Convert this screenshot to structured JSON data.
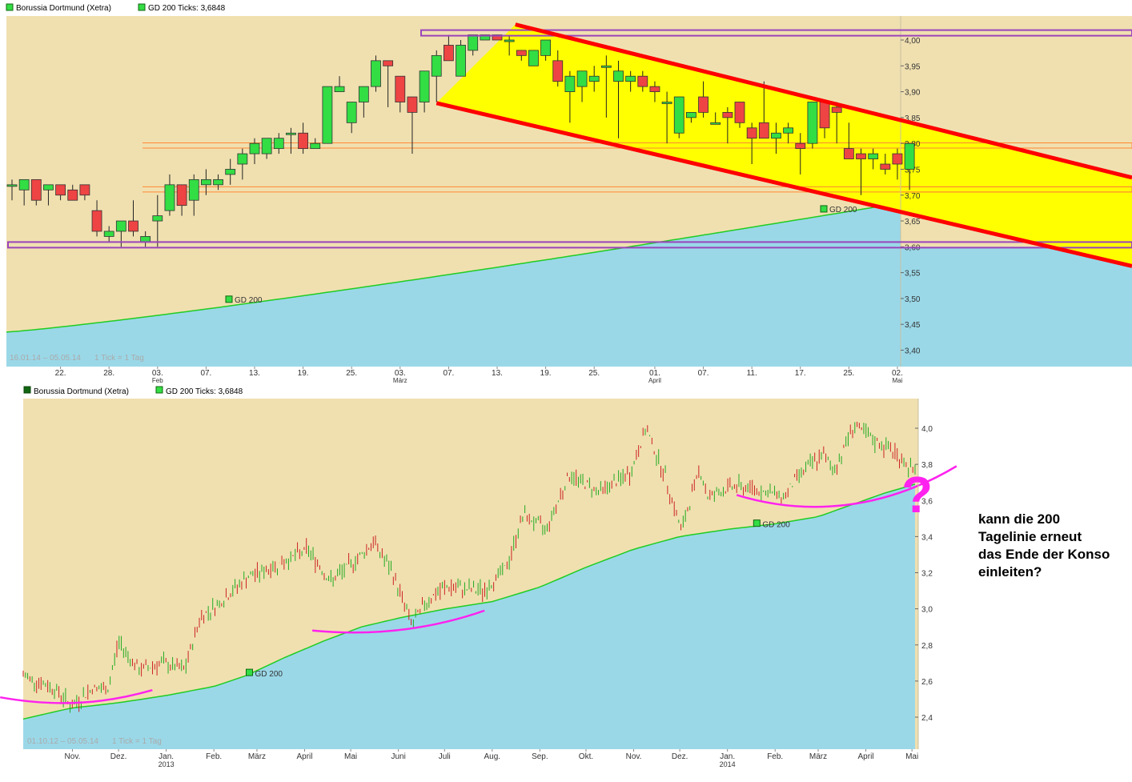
{
  "annotation": {
    "question_mark": "?",
    "lines": [
      "kann die 200",
      "Tagelinie erneut",
      "das Ende der Konso",
      "einleiten?"
    ]
  },
  "colors": {
    "up_candle": "#33dd44",
    "down_candle": "#ee4444",
    "price_area": "#f0e0b0",
    "ma_area": "#9ad8e8",
    "ma_line": "#22cc22",
    "channel": "#ff0000",
    "channel_fill": "#ffff00",
    "box_outline": "#9944bb",
    "hline": "#ff8833",
    "bars": "#cc2222",
    "bars_up": "#22aa22",
    "annotation": "#ff22ee"
  },
  "chart_data": [
    {
      "type": "candlestick",
      "title": "Borussia Dortmund (Xetra)",
      "legend": [
        {
          "label": "Borussia Dortmund (Xetra)",
          "color": "#33dd44"
        },
        {
          "label": "GD 200 Ticks: 3,6848",
          "color": "#33dd44"
        }
      ],
      "range_label": "16.01.14 – 05.05.14",
      "tick_label": "1 Tick = 1 Tag",
      "y_ticks": [
        "3,40",
        "3,45",
        "3,50",
        "3,55",
        "3,60",
        "3,65",
        "3,70",
        "3,75",
        "3,80",
        "3,85",
        "3,90",
        "3,95",
        "4,00"
      ],
      "y_tick_values": [
        3.4,
        3.45,
        3.5,
        3.55,
        3.6,
        3.65,
        3.7,
        3.75,
        3.8,
        3.85,
        3.9,
        3.95,
        4.0
      ],
      "ylim": [
        3.365,
        4.03
      ],
      "x_labels": [
        {
          "i": 4,
          "label": "22."
        },
        {
          "i": 8,
          "label": "28."
        },
        {
          "i": 12,
          "label": "03.",
          "sub": "Feb"
        },
        {
          "i": 16,
          "label": "07."
        },
        {
          "i": 20,
          "label": "13."
        },
        {
          "i": 24,
          "label": "19."
        },
        {
          "i": 28,
          "label": "25."
        },
        {
          "i": 32,
          "label": "03.",
          "sub": "März"
        },
        {
          "i": 36,
          "label": "07."
        },
        {
          "i": 40,
          "label": "13."
        },
        {
          "i": 44,
          "label": "19."
        },
        {
          "i": 48,
          "label": "25."
        },
        {
          "i": 53,
          "label": "01.",
          "sub": "April"
        },
        {
          "i": 57,
          "label": "07."
        },
        {
          "i": 61,
          "label": "11."
        },
        {
          "i": 65,
          "label": "17."
        },
        {
          "i": 69,
          "label": "25."
        },
        {
          "i": 73,
          "label": "02.",
          "sub": "Mai"
        }
      ],
      "candles": [
        [
          3.72,
          3.73,
          3.69,
          3.72
        ],
        [
          3.71,
          3.72,
          3.68,
          3.73
        ],
        [
          3.73,
          3.73,
          3.68,
          3.69
        ],
        [
          3.71,
          3.72,
          3.68,
          3.72
        ],
        [
          3.72,
          3.72,
          3.69,
          3.7
        ],
        [
          3.71,
          3.72,
          3.69,
          3.69
        ],
        [
          3.72,
          3.72,
          3.69,
          3.7
        ],
        [
          3.67,
          3.69,
          3.62,
          3.63
        ],
        [
          3.62,
          3.64,
          3.61,
          3.63
        ],
        [
          3.63,
          3.65,
          3.6,
          3.65
        ],
        [
          3.65,
          3.69,
          3.62,
          3.63
        ],
        [
          3.61,
          3.63,
          3.6,
          3.62
        ],
        [
          3.65,
          3.7,
          3.6,
          3.66
        ],
        [
          3.67,
          3.74,
          3.66,
          3.72
        ],
        [
          3.72,
          3.72,
          3.66,
          3.68
        ],
        [
          3.69,
          3.74,
          3.66,
          3.73
        ],
        [
          3.72,
          3.75,
          3.7,
          3.73
        ],
        [
          3.72,
          3.74,
          3.71,
          3.73
        ],
        [
          3.74,
          3.77,
          3.72,
          3.75
        ],
        [
          3.76,
          3.79,
          3.73,
          3.78
        ],
        [
          3.78,
          3.81,
          3.76,
          3.8
        ],
        [
          3.78,
          3.81,
          3.77,
          3.81
        ],
        [
          3.79,
          3.82,
          3.78,
          3.81
        ],
        [
          3.82,
          3.83,
          3.78,
          3.82
        ],
        [
          3.82,
          3.84,
          3.78,
          3.79
        ],
        [
          3.79,
          3.81,
          3.79,
          3.8
        ],
        [
          3.8,
          3.91,
          3.8,
          3.91
        ],
        [
          3.9,
          3.93,
          3.9,
          3.91
        ],
        [
          3.84,
          3.88,
          3.82,
          3.88
        ],
        [
          3.88,
          3.9,
          3.85,
          3.91
        ],
        [
          3.91,
          3.97,
          3.9,
          3.96
        ],
        [
          3.96,
          3.96,
          3.87,
          3.95
        ],
        [
          3.93,
          3.93,
          3.86,
          3.88
        ],
        [
          3.89,
          3.89,
          3.78,
          3.86
        ],
        [
          3.88,
          3.93,
          3.86,
          3.94
        ],
        [
          3.93,
          3.98,
          3.88,
          3.97
        ],
        [
          3.99,
          4.01,
          3.96,
          3.96
        ],
        [
          3.93,
          4.0,
          3.93,
          3.99
        ],
        [
          3.98,
          4.0,
          3.97,
          4.01
        ],
        [
          4.0,
          4.01,
          4.0,
          4.01
        ],
        [
          4.01,
          4.01,
          4.0,
          4.0
        ],
        [
          4.0,
          4.01,
          3.97,
          4.0
        ],
        [
          3.98,
          3.98,
          3.96,
          3.97
        ],
        [
          3.95,
          3.98,
          3.95,
          3.98
        ],
        [
          3.97,
          4.0,
          3.96,
          4.0
        ],
        [
          3.96,
          3.98,
          3.91,
          3.92
        ],
        [
          3.9,
          3.94,
          3.84,
          3.93
        ],
        [
          3.91,
          3.94,
          3.88,
          3.94
        ],
        [
          3.92,
          3.95,
          3.9,
          3.93
        ],
        [
          3.95,
          3.97,
          3.85,
          3.95
        ],
        [
          3.92,
          3.96,
          3.81,
          3.94
        ],
        [
          3.92,
          3.94,
          3.9,
          3.93
        ],
        [
          3.93,
          3.94,
          3.9,
          3.91
        ],
        [
          3.91,
          3.92,
          3.88,
          3.9
        ],
        [
          3.88,
          3.9,
          3.8,
          3.88
        ],
        [
          3.82,
          3.89,
          3.81,
          3.89
        ],
        [
          3.85,
          3.86,
          3.84,
          3.86
        ],
        [
          3.89,
          3.92,
          3.85,
          3.86
        ],
        [
          3.84,
          3.86,
          3.84,
          3.84
        ],
        [
          3.86,
          3.87,
          3.8,
          3.85
        ],
        [
          3.88,
          3.88,
          3.83,
          3.84
        ],
        [
          3.83,
          3.84,
          3.76,
          3.81
        ],
        [
          3.84,
          3.92,
          3.81,
          3.81
        ],
        [
          3.81,
          3.84,
          3.78,
          3.82
        ],
        [
          3.82,
          3.84,
          3.8,
          3.83
        ],
        [
          3.8,
          3.82,
          3.74,
          3.79
        ],
        [
          3.8,
          3.88,
          3.79,
          3.88
        ],
        [
          3.88,
          3.88,
          3.81,
          3.83
        ],
        [
          3.87,
          3.88,
          3.8,
          3.86
        ],
        [
          3.79,
          3.84,
          3.78,
          3.77
        ],
        [
          3.78,
          3.79,
          3.7,
          3.77
        ],
        [
          3.77,
          3.79,
          3.75,
          3.78
        ],
        [
          3.76,
          3.78,
          3.74,
          3.75
        ],
        [
          3.78,
          3.79,
          3.73,
          3.76
        ],
        [
          3.75,
          3.8,
          3.71,
          3.8
        ]
      ],
      "ma_200_start": 3.435,
      "ma_200_end": 3.685,
      "ma_label": "GD 200",
      "horizontal_levels": [
        3.801,
        3.791,
        3.716,
        3.706
      ],
      "resistance_box": [
        4.013,
        4.005
      ],
      "support_box": [
        3.603,
        3.596
      ],
      "channel_upper": [
        [
          41.5,
          4.03
        ],
        [
          87.0,
          3.765
        ]
      ],
      "channel_lower": [
        [
          35.0,
          3.878
        ],
        [
          87.0,
          3.592
        ]
      ]
    },
    {
      "type": "bar",
      "title": "Borussia Dortmund (Xetra)",
      "legend": [
        {
          "label": "Borussia Dortmund (Xetra)",
          "color": "#116611"
        },
        {
          "label": "GD 200 Ticks: 3,6848",
          "color": "#33dd44"
        }
      ],
      "range_label": "01.10.12 – 05.05.14",
      "tick_label": "1 Tick = 1 Tag",
      "y_ticks": [
        "2,4",
        "2,6",
        "2,8",
        "3,0",
        "3,2",
        "3,4",
        "3,6",
        "3,8",
        "4,0"
      ],
      "y_tick_values": [
        2.4,
        2.6,
        2.8,
        3.0,
        3.2,
        3.4,
        3.6,
        3.8,
        4.0
      ],
      "ylim": [
        2.2,
        4.04
      ],
      "x_labels": [
        {
          "d": 32,
          "label": "Nov."
        },
        {
          "d": 62,
          "label": "Dez."
        },
        {
          "d": 93,
          "label": "Jan.",
          "sub": "2013"
        },
        {
          "d": 124,
          "label": "Feb."
        },
        {
          "d": 152,
          "label": "März"
        },
        {
          "d": 183,
          "label": "April"
        },
        {
          "d": 213,
          "label": "Mai"
        },
        {
          "d": 244,
          "label": "Juni"
        },
        {
          "d": 274,
          "label": "Juli"
        },
        {
          "d": 305,
          "label": "Aug."
        },
        {
          "d": 336,
          "label": "Sep."
        },
        {
          "d": 366,
          "label": "Okt."
        },
        {
          "d": 397,
          "label": "Nov."
        },
        {
          "d": 427,
          "label": "Dez."
        },
        {
          "d": 458,
          "label": "Jan.",
          "sub": "2014"
        },
        {
          "d": 489,
          "label": "Feb."
        },
        {
          "d": 517,
          "label": "März"
        },
        {
          "d": 548,
          "label": "April"
        },
        {
          "d": 578,
          "label": "Mai"
        }
      ],
      "price_path": [
        [
          0,
          2.63
        ],
        [
          20,
          2.56
        ],
        [
          32,
          2.46
        ],
        [
          45,
          2.56
        ],
        [
          55,
          2.55
        ],
        [
          62,
          2.82
        ],
        [
          75,
          2.66
        ],
        [
          90,
          2.7
        ],
        [
          105,
          2.66
        ],
        [
          115,
          2.95
        ],
        [
          130,
          3.05
        ],
        [
          145,
          3.17
        ],
        [
          165,
          3.24
        ],
        [
          185,
          3.33
        ],
        [
          200,
          3.15
        ],
        [
          215,
          3.26
        ],
        [
          228,
          3.37
        ],
        [
          240,
          3.2
        ],
        [
          253,
          2.91
        ],
        [
          262,
          3.04
        ],
        [
          275,
          3.12
        ],
        [
          300,
          3.1
        ],
        [
          315,
          3.24
        ],
        [
          325,
          3.52
        ],
        [
          340,
          3.44
        ],
        [
          355,
          3.74
        ],
        [
          375,
          3.65
        ],
        [
          395,
          3.75
        ],
        [
          405,
          4.0
        ],
        [
          418,
          3.72
        ],
        [
          428,
          3.43
        ],
        [
          440,
          3.78
        ],
        [
          445,
          3.62
        ],
        [
          462,
          3.68
        ],
        [
          478,
          3.66
        ],
        [
          495,
          3.62
        ],
        [
          505,
          3.75
        ],
        [
          520,
          3.85
        ],
        [
          528,
          3.77
        ],
        [
          540,
          4.02
        ],
        [
          553,
          3.93
        ],
        [
          565,
          3.88
        ],
        [
          580,
          3.75
        ]
      ],
      "ma_200": [
        [
          0,
          2.39
        ],
        [
          31,
          2.45
        ],
        [
          62,
          2.48
        ],
        [
          93,
          2.52
        ],
        [
          124,
          2.57
        ],
        [
          145,
          2.63
        ],
        [
          170,
          2.73
        ],
        [
          195,
          2.82
        ],
        [
          220,
          2.9
        ],
        [
          245,
          2.95
        ],
        [
          275,
          3.0
        ],
        [
          305,
          3.04
        ],
        [
          336,
          3.12
        ],
        [
          366,
          3.23
        ],
        [
          397,
          3.33
        ],
        [
          427,
          3.4
        ],
        [
          458,
          3.44
        ],
        [
          489,
          3.47
        ],
        [
          517,
          3.51
        ],
        [
          540,
          3.58
        ],
        [
          560,
          3.64
        ],
        [
          580,
          3.69
        ]
      ],
      "ma_label": "GD 200",
      "curves": [
        [
          [
            -15,
            2.51
          ],
          [
            25,
            2.45
          ],
          [
            55,
            2.48
          ],
          [
            84,
            2.55
          ]
        ],
        [
          [
            188,
            2.88
          ],
          [
            225,
            2.85
          ],
          [
            263,
            2.88
          ],
          [
            300,
            2.99
          ]
        ],
        [
          [
            464,
            3.63
          ],
          [
            510,
            3.51
          ],
          [
            560,
            3.55
          ],
          [
            607,
            3.79
          ]
        ]
      ]
    }
  ]
}
